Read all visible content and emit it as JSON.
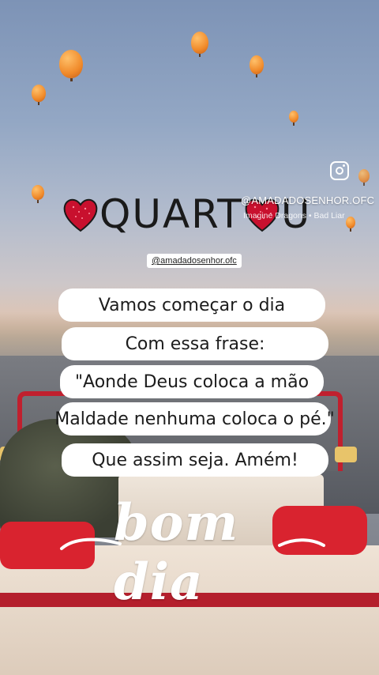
{
  "header": {
    "title_before": "QUART",
    "title_after": "U",
    "instagram_handle": "@AMADADOSENHOR.OFC",
    "music": "Imagine Dragons • Bad Liar"
  },
  "tag": {
    "handle": "@amadadosenhor.ofc"
  },
  "message": {
    "lines": [
      "Vamos começar o dia",
      "Com essa frase:",
      "\"Aonde Deus coloca a mão",
      "Maldade nenhuma coloca o pé.\"",
      "Que assim seja. Amém!"
    ]
  },
  "greeting": {
    "text": "bom dia"
  },
  "colors": {
    "heart": "#c8102e",
    "accent_red": "#d9232f",
    "text": "#1c1c1c"
  },
  "icons": {
    "instagram": "instagram-icon",
    "heart": "heart-icon"
  }
}
